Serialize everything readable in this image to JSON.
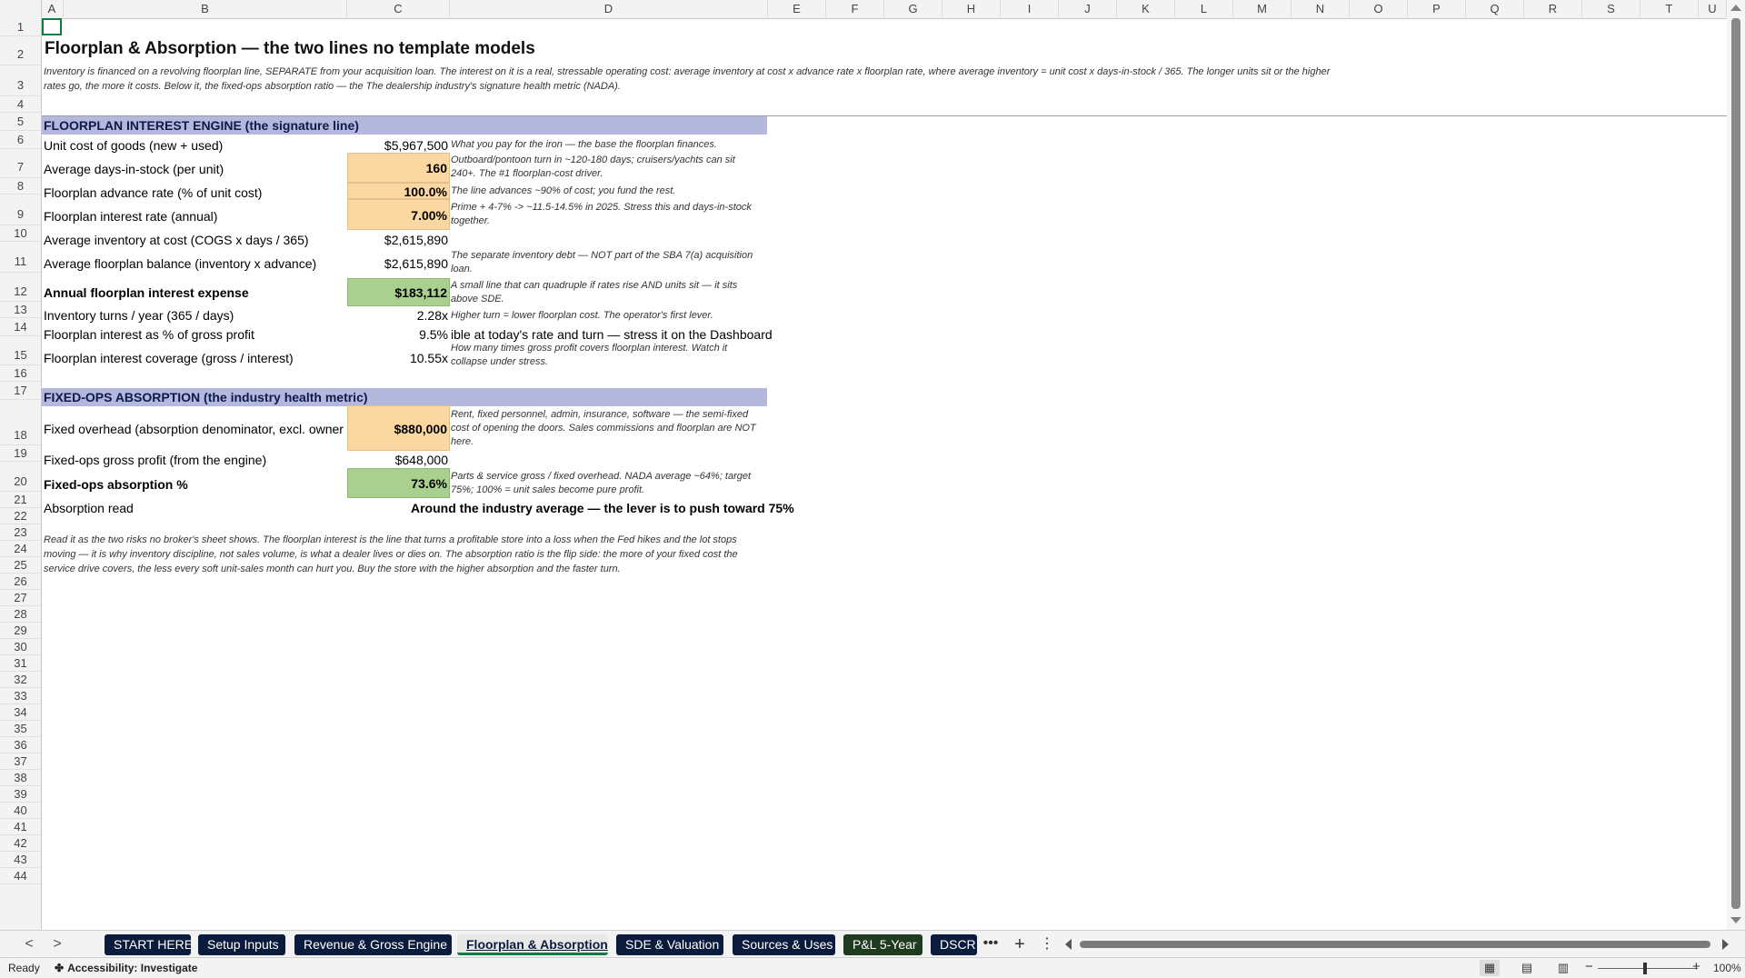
{
  "columns": [
    "A",
    "B",
    "C",
    "D",
    "E",
    "F",
    "G",
    "H",
    "I",
    "J",
    "K",
    "L",
    "M",
    "N",
    "O",
    "P",
    "Q",
    "R",
    "S",
    "T",
    "U"
  ],
  "rows": [
    "1",
    "2",
    "3",
    "4",
    "5",
    "6",
    "7",
    "8",
    "9",
    "10",
    "11",
    "12",
    "13",
    "14",
    "15",
    "16",
    "17",
    "18",
    "19",
    "20",
    "21",
    "22",
    "23",
    "24",
    "25",
    "26",
    "27",
    "28",
    "29",
    "30",
    "31",
    "32",
    "33",
    "34",
    "35",
    "36",
    "37",
    "38",
    "39",
    "40",
    "41",
    "42",
    "43",
    "44"
  ],
  "sheet": {
    "title": "Floorplan & Absorption — the two lines no template models",
    "intro": "Inventory is financed on a revolving floorplan line, SEPARATE from your acquisition loan. The interest on it is a real, stressable operating cost: average inventory at cost x advance rate x floorplan rate, where average inventory = unit cost x days-in-stock / 365. The longer units sit or the higher rates go, the more it costs. Below it, the fixed-ops absorption ratio — the The dealership industry's signature health metric (NADA).",
    "section1_header": "FLOORPLAN INTEREST ENGINE  (the signature line)",
    "section2_header": "FIXED-OPS ABSORPTION  (the industry health metric)",
    "lines": {
      "unit_cost": {
        "label": "Unit cost of goods (new + used)",
        "value": "$5,967,500",
        "note": "What you pay for the iron — the base the floorplan finances."
      },
      "days_in_stock": {
        "label": "Average days-in-stock (per unit)",
        "value": "160",
        "note": "Outboard/pontoon turn in ~120-180 days; cruisers/yachts can sit 240+. The #1 floorplan-cost driver."
      },
      "advance_rate": {
        "label": "Floorplan advance rate (% of unit cost)",
        "value": "100.0%",
        "note": "The line advances ~90% of cost; you fund the rest."
      },
      "interest_rate": {
        "label": "Floorplan interest rate (annual)",
        "value": "7.00%",
        "note": "Prime + 4-7% -> ~11.5-14.5% in 2025. Stress this and days-in-stock together."
      },
      "avg_inventory": {
        "label": "Average inventory at cost (COGS x days / 365)",
        "value": "$2,615,890"
      },
      "avg_balance": {
        "label": "Average floorplan balance (inventory x advance)",
        "value": "$2,615,890",
        "note": "The separate inventory debt — NOT part of the SBA 7(a) acquisition loan."
      },
      "annual_interest": {
        "label": "Annual floorplan interest expense",
        "value": "$183,112",
        "note": "A small line that can quadruple if rates rise AND units sit — it sits above SDE."
      },
      "turns": {
        "label": "Inventory turns / year (365 / days)",
        "value": "2.28x",
        "note": "Higher turn = lower floorplan cost. The operator's first lever."
      },
      "pct_gross": {
        "label": "Floorplan interest as % of gross profit",
        "value": "9.5%",
        "note": "ible at today's rate and turn — stress it on the Dashboard"
      },
      "coverage": {
        "label": "Floorplan interest coverage (gross / interest)",
        "value": "10.55x",
        "note": "How many times gross profit covers floorplan interest. Watch it collapse under stress."
      },
      "fixed_overhead": {
        "label": "Fixed overhead (absorption denominator, excl. owner",
        "value": "$880,000",
        "note": "Rent, fixed personnel, admin, insurance, software — the semi-fixed cost of opening the doors. Sales commissions and floorplan are NOT here."
      },
      "fixed_ops_gp": {
        "label": "Fixed-ops gross profit (from the engine)",
        "value": "$648,000"
      },
      "absorption_pct": {
        "label": "Fixed-ops absorption %",
        "value": "73.6%",
        "note": "Parts & service gross / fixed overhead. NADA average ~64%; target 75%; 100% = unit sales become pure profit."
      },
      "absorption_read": {
        "label": "Absorption read",
        "value": "Around the industry average — the lever is to push toward 75%"
      }
    },
    "closing_note": "Read it as the two risks no broker's sheet shows. The floorplan interest is the line that turns a profitable store into a loss when the Fed hikes and the lot stops moving — it is why inventory discipline, not sales volume, is what a dealer lives or dies on. The absorption ratio is the flip side: the more of your fixed cost the service drive covers, the less every soft unit-sales month can hurt you. Buy the store with the higher absorption and the faster turn."
  },
  "tabs": [
    {
      "label": "START HERE"
    },
    {
      "label": "Setup Inputs"
    },
    {
      "label": "Revenue & Gross Engine"
    },
    {
      "label": "Floorplan & Absorption"
    },
    {
      "label": "SDE & Valuation"
    },
    {
      "label": "Sources & Uses"
    },
    {
      "label": "P&L 5-Year"
    },
    {
      "label": "DSCR &"
    }
  ],
  "tab_controls": {
    "more": "•••",
    "add": "+",
    "options": "⋮",
    "prev": "<",
    "next": ">"
  },
  "status": {
    "ready": "Ready",
    "accessibility": "Accessibility: Investigate",
    "zoom": "100%"
  },
  "colors": {
    "input_fill": "#fbd7a1",
    "output_fill": "#a9d08e",
    "section_band": "#b4b8dc",
    "tab_dark": "#0b1b3c"
  },
  "icons": {
    "accessibility": "accessibility-icon",
    "normal_view": "normal-view-icon",
    "page_layout": "page-layout-icon",
    "page_break": "page-break-icon"
  }
}
